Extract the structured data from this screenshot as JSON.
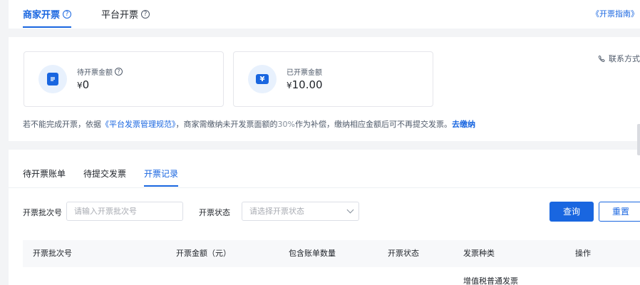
{
  "top_tabs": [
    {
      "label": "商家开票",
      "active": true
    },
    {
      "label": "平台开票",
      "active": false
    }
  ],
  "guide_link": "《开票指南》",
  "cards": [
    {
      "label": "待开票金额",
      "currency": "¥",
      "value": "0",
      "icon": "document-icon"
    },
    {
      "label": "已开票金额",
      "currency": "¥",
      "value": "10.00",
      "icon": "yen-ticket-icon"
    }
  ],
  "contact": "联系方式",
  "notice": {
    "prefix": "若不能完成开票，依据",
    "link": "《平台发票管理规范》",
    "middle": "，商家需缴纳未开发票面额的",
    "percent": "30%",
    "suffix": "作为补偿，缴纳相应金额后可不再提交发票。",
    "action": "去缴纳"
  },
  "sub_tabs": [
    {
      "label": "待开票账单",
      "active": false
    },
    {
      "label": "待提交发票",
      "active": false
    },
    {
      "label": "开票记录",
      "active": true
    }
  ],
  "filters": {
    "batch_label": "开票批次号",
    "batch_placeholder": "请输入开票批次号",
    "status_label": "开票状态",
    "status_placeholder": "请选择开票状态"
  },
  "buttons": {
    "query": "查询",
    "reset": "重置"
  },
  "table": {
    "columns": [
      "开票批次号",
      "开票金额（元）",
      "包含账单数量",
      "开票状态",
      "发票种类",
      "操作"
    ],
    "rows": [
      {
        "invoice_type": "增值税普通发票"
      }
    ]
  },
  "colors": {
    "accent": "#1966e0",
    "background": "#f3f4f6"
  }
}
